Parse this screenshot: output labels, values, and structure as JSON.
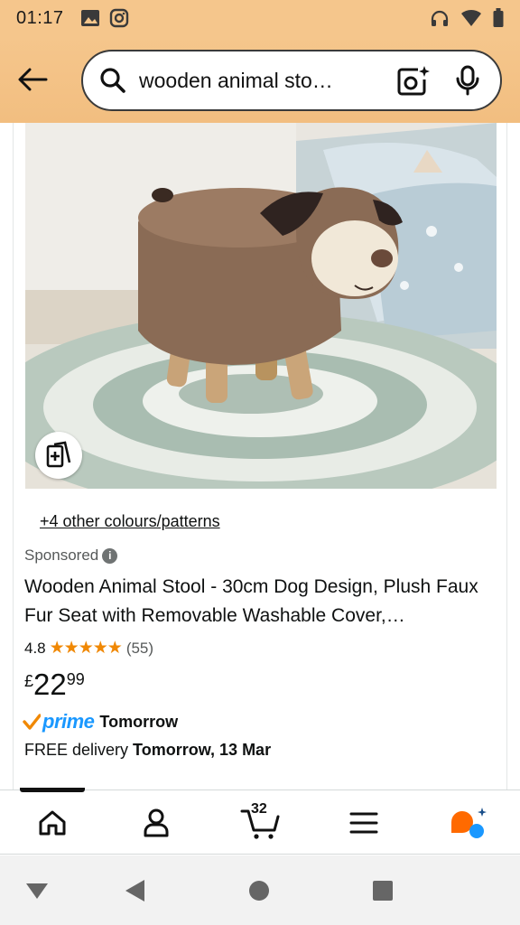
{
  "status_bar": {
    "time": "01:17",
    "left_icons": [
      "image-icon",
      "instagram-icon"
    ],
    "right_icons": [
      "headphones-icon",
      "wifi-icon",
      "battery-icon"
    ]
  },
  "search": {
    "query": "wooden animal sto…",
    "back_icon": "arrow-left-icon",
    "search_icon": "search-icon",
    "camera_icon": "camera-lens-icon",
    "mic_icon": "mic-icon"
  },
  "product": {
    "image_desc_icon": "compare-icon",
    "colours_link": "+4 other colours/patterns",
    "sponsored": "Sponsored",
    "title": "Wooden Animal Stool - 30cm Dog Design, Plush Faux Fur Seat with Removable Washable Cover,…",
    "rating": "4.8",
    "stars": "★★★★★",
    "rating_count": "(55)",
    "price_symbol": "£",
    "price_whole": "22",
    "price_fraction": "99",
    "prime_label": "prime",
    "prime_delivery": "Tomorrow",
    "delivery_prefix": "FREE delivery ",
    "delivery_date": "Tomorrow, 13 Mar"
  },
  "bottom_nav": {
    "items": [
      "home-icon",
      "account-icon",
      "cart-icon",
      "menu-icon",
      "rufus-icon"
    ],
    "cart_count": "32"
  },
  "system_nav": [
    "back-triangle",
    "home-circle",
    "recents-square"
  ],
  "colors": {
    "header": "#f5c68c",
    "prime_blue": "#1a98ff",
    "star_orange": "#f08804",
    "rufus_orange": "#ff6a00"
  }
}
